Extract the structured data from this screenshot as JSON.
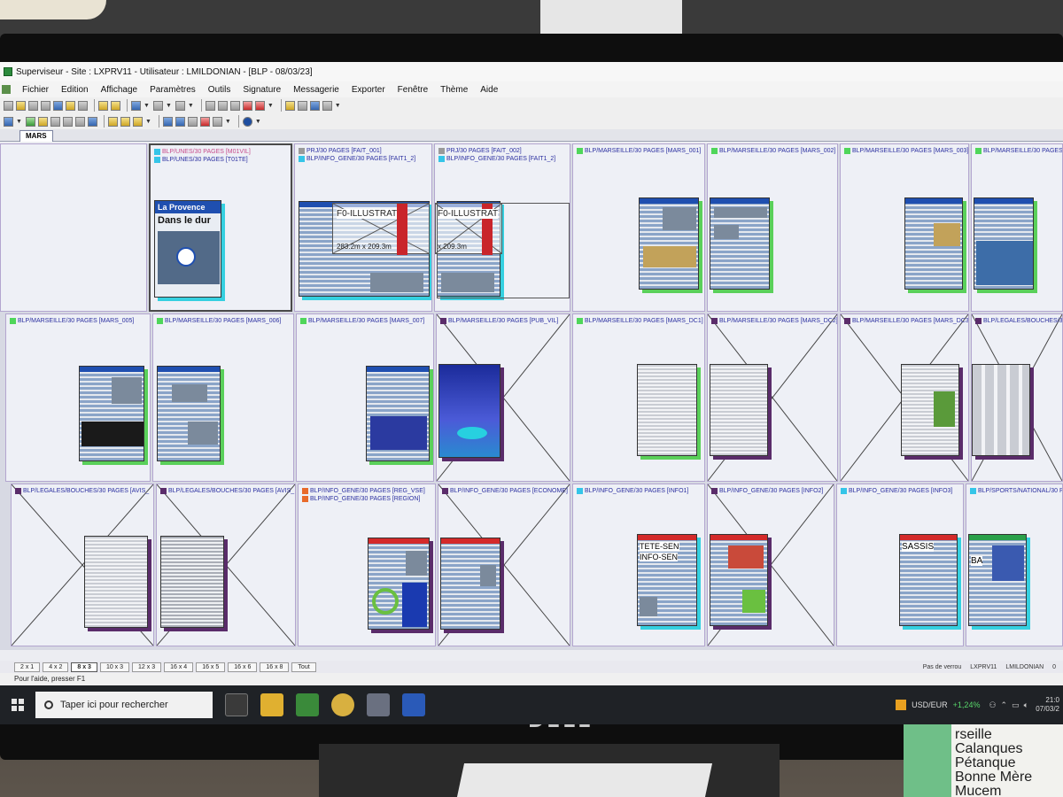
{
  "window": {
    "title": "Superviseur - Site : LXPRV11 - Utilisateur : LMILDONIAN - [BLP - 08/03/23]"
  },
  "menu": [
    "Fichier",
    "Edition",
    "Affichage",
    "Paramètres",
    "Outils",
    "Signature",
    "Messagerie",
    "Exporter",
    "Fenêtre",
    "Thème",
    "Aide"
  ],
  "tab": {
    "label": "MARS"
  },
  "cells": [
    {
      "labels": [],
      "colors": []
    },
    {
      "labels": [
        "BLP/UNES/30 PAGES [M01VIL]",
        "BLP/UNES/30 PAGES [T01TE]"
      ],
      "colors": [
        "#35c5e8",
        "#35c5e8"
      ]
    },
    {
      "labels": [
        "PRJ/30 PAGES [FAIT_001]",
        "BLP/INFO_GENE/30 PAGES [FAIT1_2]"
      ],
      "colors": [
        "#9a9a9a",
        "#35c5e8"
      ]
    },
    {
      "labels": [
        "PRJ/30 PAGES [FAIT_002]",
        "BLP/INFO_GENE/30 PAGES [FAIT1_2]"
      ],
      "colors": [
        "#9a9a9a",
        "#35c5e8"
      ]
    },
    {
      "labels": [
        "BLP/MARSEILLE/30 PAGES [MARS_001]"
      ],
      "colors": [
        "#4fd65a"
      ]
    },
    {
      "labels": [
        "BLP/MARSEILLE/30 PAGES [MARS_002]"
      ],
      "colors": [
        "#4fd65a"
      ]
    },
    {
      "labels": [
        "BLP/MARSEILLE/30 PAGES [MARS_003]"
      ],
      "colors": [
        "#4fd65a"
      ]
    },
    {
      "labels": [
        "BLP/MARSEILLE/30 PAGES [MARS"
      ],
      "colors": [
        "#4fd65a"
      ]
    },
    {
      "labels": [
        "BLP/MARSEILLE/30 PAGES [MARS_005]"
      ],
      "colors": [
        "#4fd65a"
      ]
    },
    {
      "labels": [
        "BLP/MARSEILLE/30 PAGES [MARS_006]"
      ],
      "colors": [
        "#4fd65a"
      ]
    },
    {
      "labels": [
        "BLP/MARSEILLE/30 PAGES [MARS_007]"
      ],
      "colors": [
        "#4fd65a"
      ]
    },
    {
      "labels": [
        "BLP/MARSEILLE/30 PAGES [PUB_VIL]"
      ],
      "colors": [
        "#5a2c6a"
      ]
    },
    {
      "labels": [
        "BLP/MARSEILLE/30 PAGES [MARS_DC1]"
      ],
      "colors": [
        "#4fd65a"
      ]
    },
    {
      "labels": [
        "BLP/MARSEILLE/30 PAGES [MARS_DC2]"
      ],
      "colors": [
        "#5a2c6a"
      ]
    },
    {
      "labels": [
        "BLP/MARSEILLE/30 PAGES [MARS_DC3]"
      ],
      "colors": [
        "#5a2c6a"
      ]
    },
    {
      "labels": [
        "BLP/LEGALES/BOUCHES/30 PAGES"
      ],
      "colors": [
        "#5a2c6a"
      ]
    },
    {
      "labels": [
        "BLP/LEGALES/BOUCHES/30 PAGES [AVIS_"
      ],
      "colors": [
        "#5a2c6a"
      ]
    },
    {
      "labels": [
        "BLP/LEGALES/BOUCHES/30 PAGES [AVIS_"
      ],
      "colors": [
        "#5a2c6a"
      ]
    },
    {
      "labels": [
        "BLP/INFO_GENE/30 PAGES [REG_VSE]",
        "BLP/INFO_GENE/30 PAGES [REGION]"
      ],
      "colors": [
        "#e86a2a",
        "#e86a2a"
      ]
    },
    {
      "labels": [
        "BLP/INFO_GENE/30 PAGES [ECONOME]"
      ],
      "colors": [
        "#5a2c6a"
      ]
    },
    {
      "labels": [
        "BLP/INFO_GENE/30 PAGES [INFO1]"
      ],
      "colors": [
        "#35c5e8"
      ]
    },
    {
      "labels": [
        "BLP/INFO_GENE/30 PAGES [INFO2]"
      ],
      "colors": [
        "#5a2c6a"
      ]
    },
    {
      "labels": [
        "BLP/INFO_GENE/30 PAGES [INFO3]"
      ],
      "colors": [
        "#35c5e8"
      ]
    },
    {
      "labels": [
        "BLP/SPORTS/NATIONAL/30 PAGES"
      ],
      "colors": [
        "#35c5e8"
      ]
    }
  ],
  "page_texts": {
    "provence_title": "La Provence",
    "provence_headline": "Dans le dur",
    "f0_illustrat_1": "F0-ILLUSTRAT",
    "f0_illustrat_2": "F0-ILLUSTRAT",
    "dims_1": "283.2m x 209.3m",
    "dims_2": "x 209.3m",
    "tete_sen": "TETE-SEN",
    "info_sen": "INFO-SEN",
    "sassis": "SASSIS",
    "sports_ba": "BA"
  },
  "viewbar": {
    "buttons": [
      "2 x 1",
      "4 x 2",
      "8 x 3",
      "10 x 3",
      "12 x 3",
      "16 x 4",
      "16 x 5",
      "16 x 6",
      "16 x 8",
      "Tout"
    ],
    "active": "8 x 3",
    "lock_status": "Pas de verrou",
    "site": "LXPRV11",
    "user": "LMILDONIAN",
    "extra": "0"
  },
  "statusbar": {
    "text": "Pour l'aide, presser F1"
  },
  "taskbar": {
    "search_placeholder": "Taper ici pour rechercher",
    "currency": "USD/EUR",
    "change": "+1,24%",
    "time": "21:0",
    "date": "07/03/2"
  },
  "monitor": {
    "brand": "DELL"
  },
  "poster": {
    "lines": [
      "rseille",
      "Calanques",
      "Pétanque",
      "Bonne Mère",
      "Mucem"
    ]
  }
}
